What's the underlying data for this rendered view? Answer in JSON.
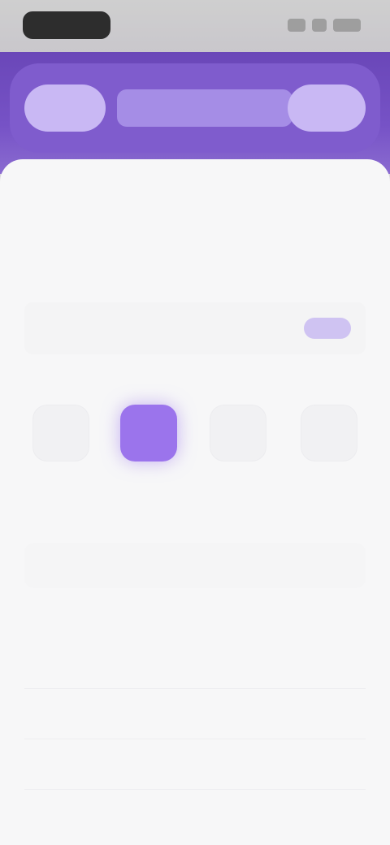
{
  "status_bar": {
    "time": "",
    "icons": [
      "signal-icon",
      "wifi-icon",
      "battery-icon"
    ]
  },
  "header": {
    "left_button": "",
    "title": "",
    "right_button": ""
  },
  "sheet": {
    "title": "",
    "section_1_label": "",
    "row_1": {
      "label": "",
      "value": ""
    },
    "section_2_label": "",
    "options": [
      {
        "label": "",
        "selected": false
      },
      {
        "label": "",
        "selected": true
      },
      {
        "label": "",
        "selected": false
      },
      {
        "label": "",
        "selected": false
      }
    ],
    "section_3_label": "",
    "action_button": "",
    "list_header": "",
    "list_items": [
      "",
      "",
      ""
    ]
  },
  "colors": {
    "accent": "#7652c6",
    "selected": "#9b74ec",
    "background": "#f7f7f8"
  }
}
